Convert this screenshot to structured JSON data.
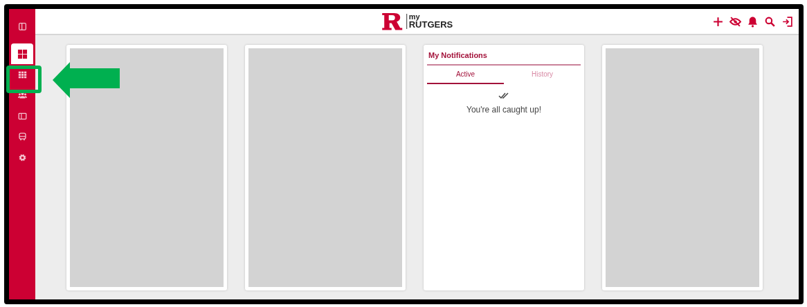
{
  "sidebar": {
    "items": [
      {
        "selected": true,
        "highlighted": false
      },
      {
        "selected": false,
        "highlighted": true
      },
      {
        "selected": false,
        "highlighted": false
      },
      {
        "selected": false,
        "highlighted": false
      },
      {
        "selected": false,
        "highlighted": false
      },
      {
        "selected": false,
        "highlighted": false
      }
    ]
  },
  "header": {
    "logo_small": "my",
    "logo_large": "RUTGERS"
  },
  "cards": [
    {
      "kind": "placeholder"
    },
    {
      "kind": "placeholder"
    },
    {
      "kind": "notifications",
      "title": "My Notifications",
      "tabs": [
        {
          "label": "Active",
          "selected": true
        },
        {
          "label": "History",
          "selected": false
        }
      ],
      "message": "You're all caught up!"
    },
    {
      "kind": "placeholder"
    }
  ]
}
